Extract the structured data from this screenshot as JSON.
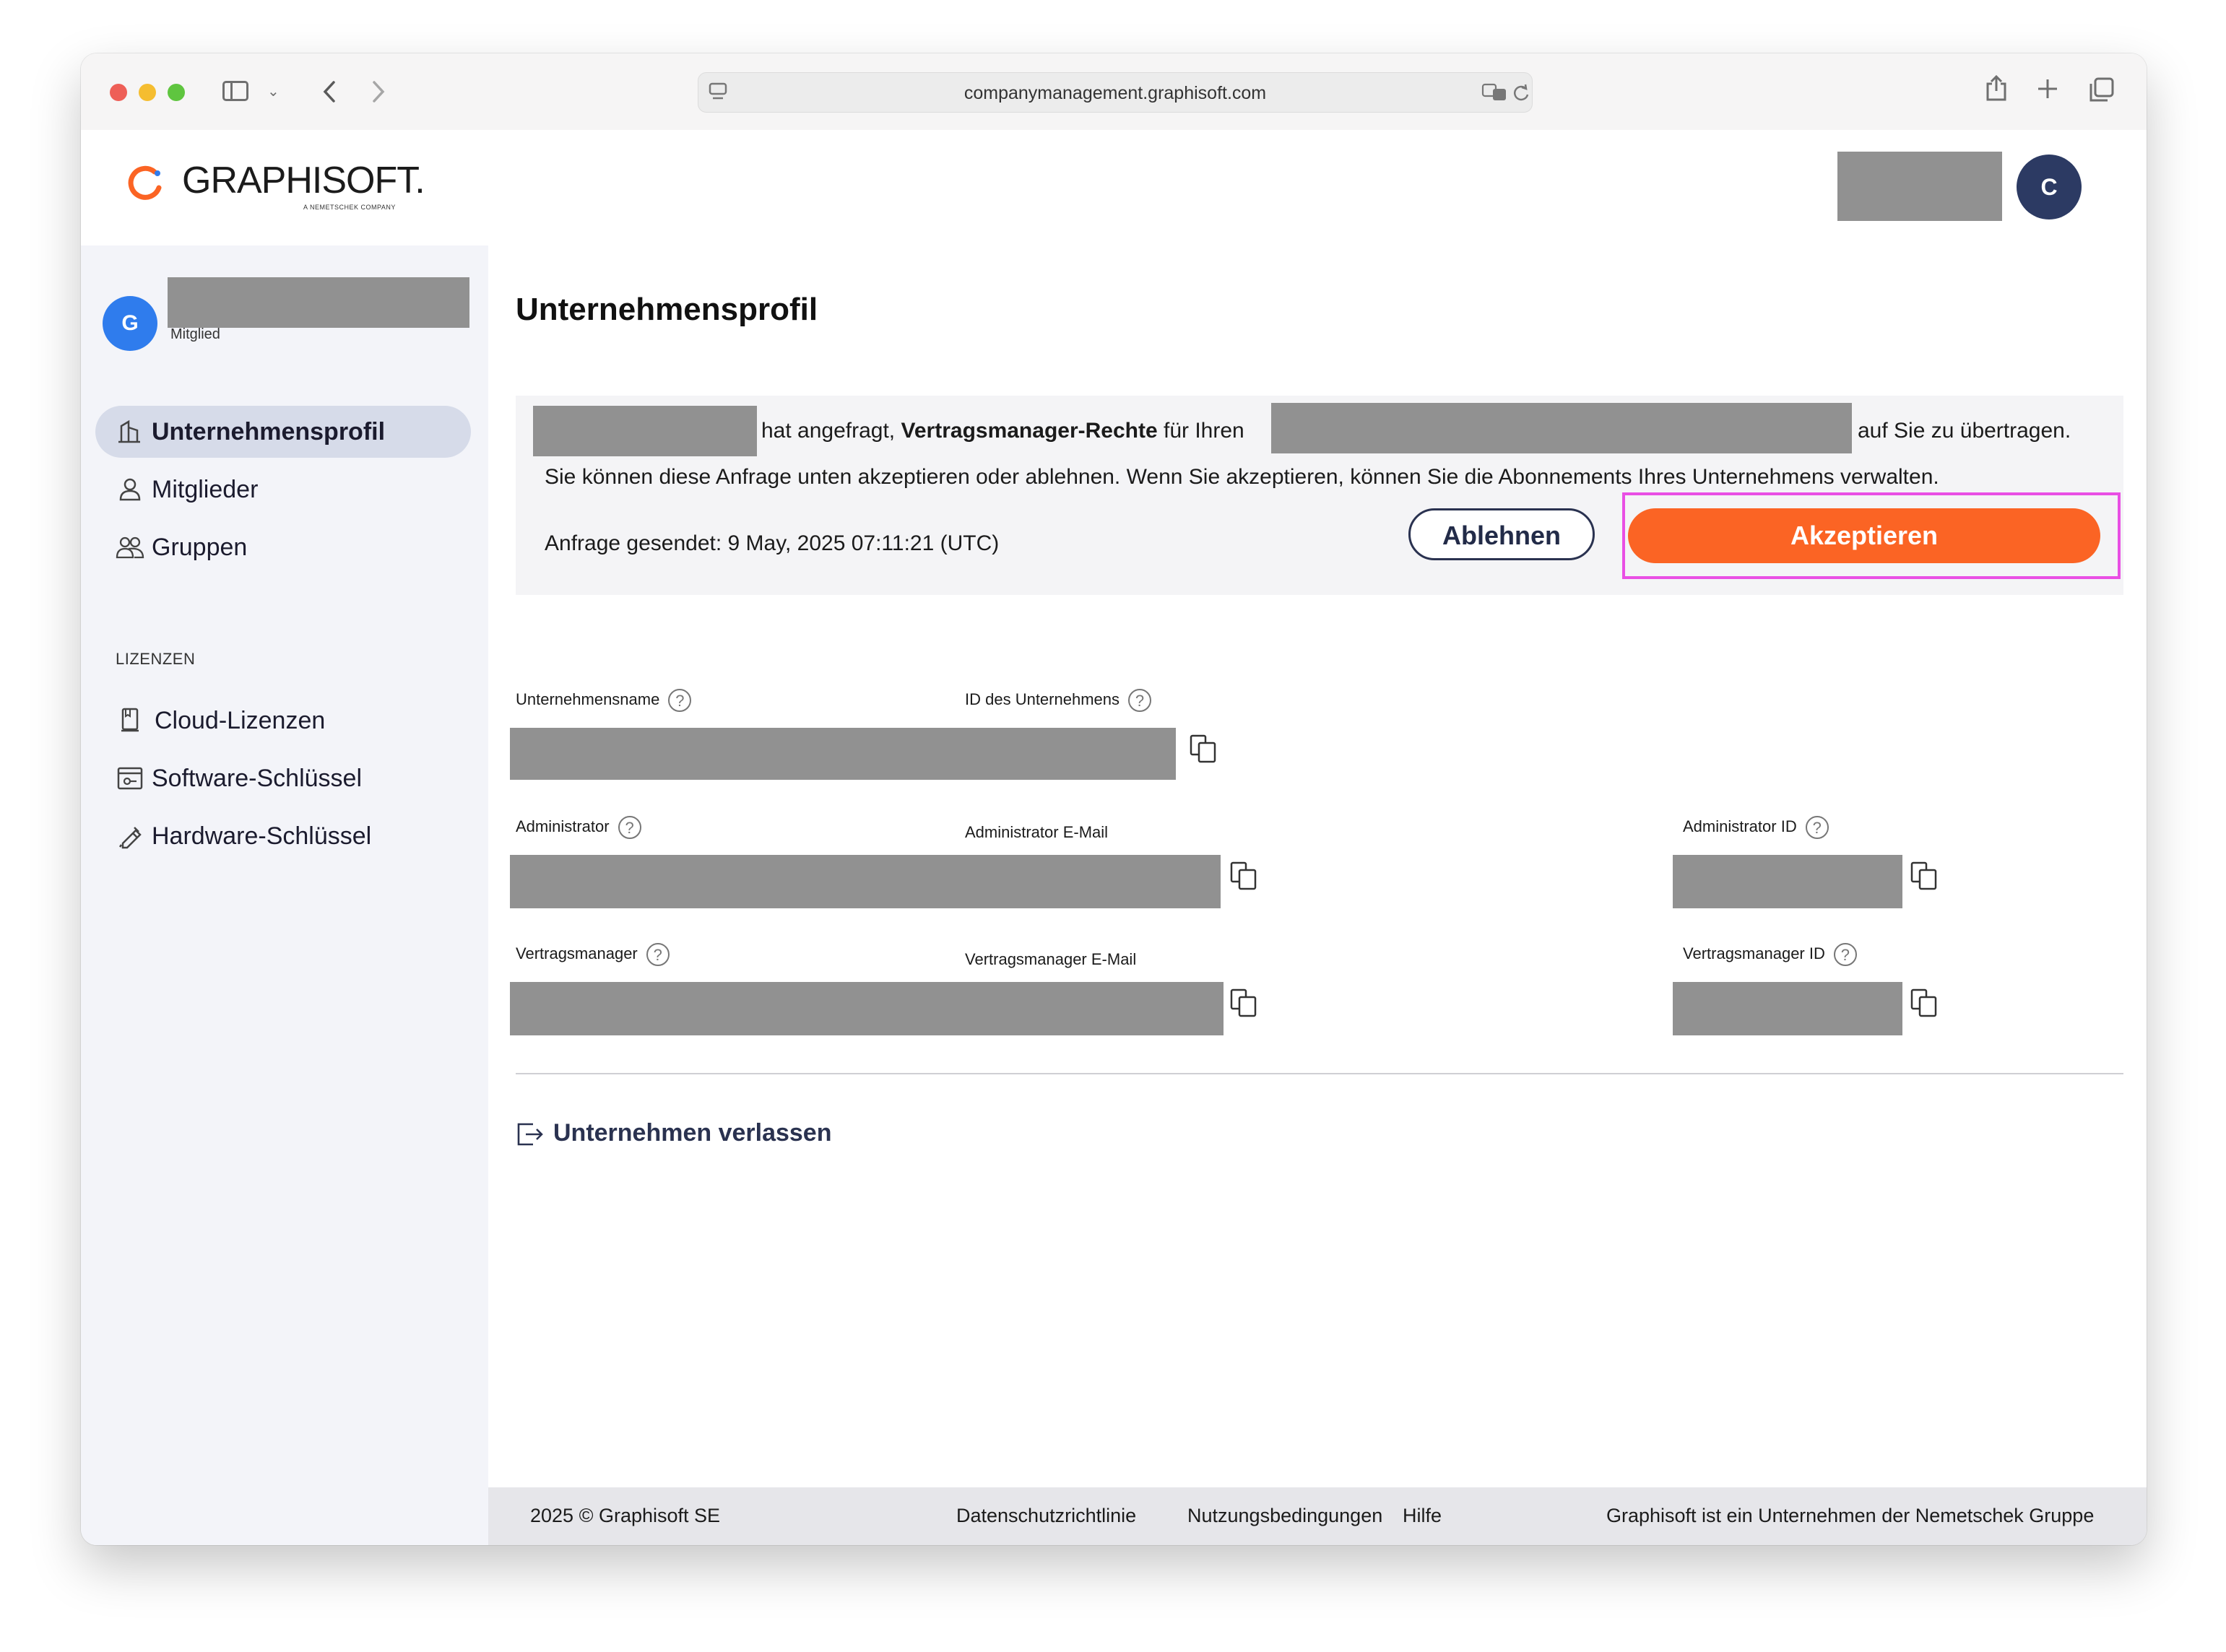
{
  "browser": {
    "url": "companymanagement.graphisoft.com"
  },
  "header": {
    "logo_text": "GRAPHISOFT.",
    "logo_sub": "A NEMETSCHEK COMPANY",
    "avatar_initial": "C"
  },
  "sidebar": {
    "avatar_initial": "G",
    "role": "Mitglied",
    "items": [
      {
        "label": "Unternehmensprofil",
        "icon": "building-icon",
        "active": true
      },
      {
        "label": "Mitglieder",
        "icon": "person-icon"
      },
      {
        "label": "Gruppen",
        "icon": "group-icon"
      }
    ],
    "section_label": "LIZENZEN",
    "license_items": [
      {
        "label": "Cloud-Lizenzen",
        "icon": "cloud-license-icon"
      },
      {
        "label": "Software-Schlüssel",
        "icon": "software-key-icon"
      },
      {
        "label": "Hardware-Schlüssel",
        "icon": "hardware-key-icon"
      }
    ]
  },
  "main": {
    "title": "Unternehmensprofil",
    "request": {
      "text_a": "hat angefragt,",
      "text_bold": "Vertragsmanager-Rechte",
      "text_b": "für Ihren",
      "text_c": "auf Sie zu übertragen.",
      "line2": "Sie können diese Anfrage unten akzeptieren oder ablehnen. Wenn Sie akzeptieren, können Sie die Abonnements Ihres Unternehmens verwalten.",
      "sent": "Anfrage gesendet: 9 May, 2025 07:11:21 (UTC)",
      "decline_label": "Ablehnen",
      "accept_label": "Akzeptieren"
    },
    "fields": {
      "company_name": "Unternehmensname",
      "company_id": "ID des Unternehmens",
      "admin": "Administrator",
      "admin_email": "Administrator E-Mail",
      "admin_id": "Administrator ID",
      "contract_manager": "Vertragsmanager",
      "contract_manager_email": "Vertragsmanager E-Mail",
      "contract_manager_id": "Vertragsmanager ID"
    },
    "leave_label": "Unternehmen verlassen"
  },
  "footer": {
    "copyright": "2025 © Graphisoft SE",
    "privacy": "Datenschutzrichtlinie",
    "terms": "Nutzungsbedingungen",
    "help": "Hilfe",
    "company_note": "Graphisoft ist ein Unternehmen der Nemetschek Gruppe"
  },
  "colors": {
    "accent": "#fb6424",
    "navy": "#2a3250",
    "avatar_blue": "#2f7ced",
    "highlight": "#e94fe4"
  }
}
